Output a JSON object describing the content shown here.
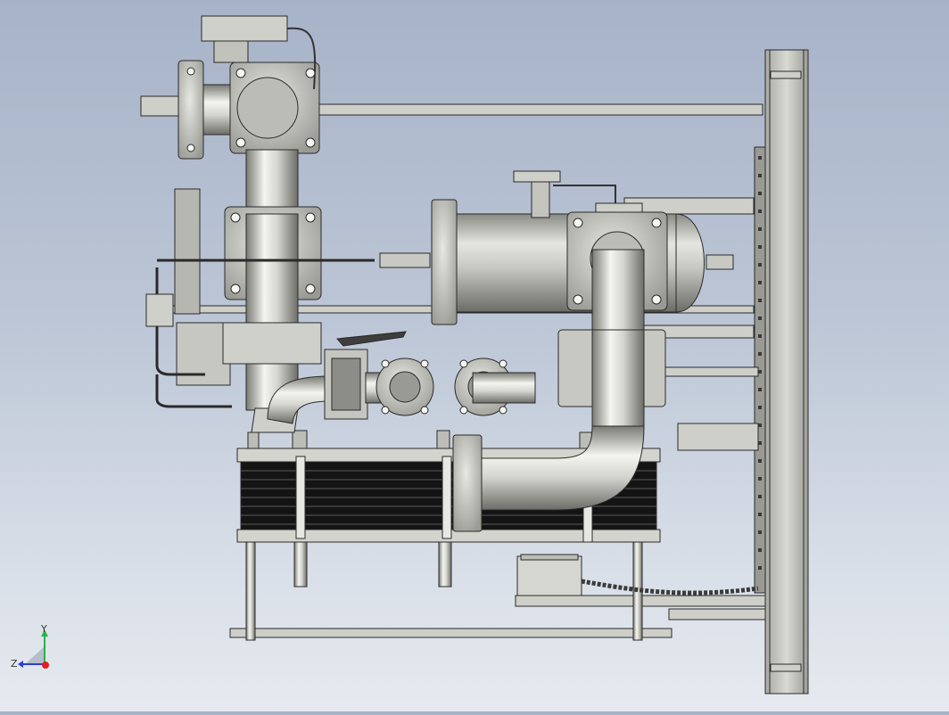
{
  "viewport": {
    "background_top": "#a7b3c8",
    "background_bottom": "#e6eaf0",
    "model_description_visible": false
  },
  "triad": {
    "y_label": "Y",
    "z_label": "Z",
    "y_color": "#2bb24c",
    "z_color": "#2a3fd6",
    "x_color": "#e02020"
  },
  "colors": {
    "metal_light": "#f2f2ee",
    "metal_mid": "#b9b9b2",
    "metal_dark": "#6e6e68",
    "plate_dark": "#1a1a1a",
    "outline": "#2a2a2a"
  }
}
